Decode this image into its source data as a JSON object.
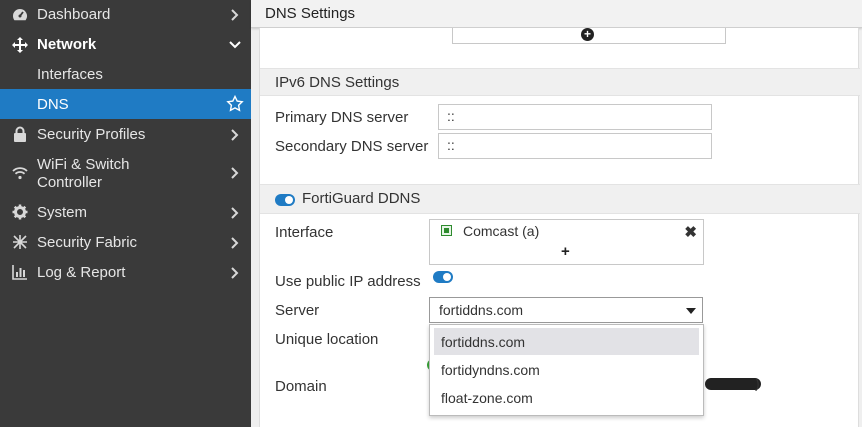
{
  "sidebar": {
    "items": [
      {
        "label": "Dashboard",
        "icon": "dashboard-icon"
      },
      {
        "label": "Network",
        "icon": "network-icon"
      },
      {
        "label": "Interfaces"
      },
      {
        "label": "DNS",
        "icon": "star-icon"
      },
      {
        "label": "Security Profiles",
        "icon": "lock-icon"
      },
      {
        "label": "WiFi & Switch",
        "label2": "Controller",
        "icon": "wifi-icon"
      },
      {
        "label": "System",
        "icon": "gear-icon"
      },
      {
        "label": "Security Fabric",
        "icon": "fabric-icon"
      },
      {
        "label": "Log & Report",
        "icon": "chart-icon"
      }
    ],
    "active_color": "#1f7bc4"
  },
  "header": {
    "title": "DNS Settings"
  },
  "ipv6": {
    "section_title": "IPv6 DNS Settings",
    "primary_label": "Primary DNS server",
    "primary_value": "::",
    "secondary_label": "Secondary DNS server",
    "secondary_value": "::"
  },
  "ddns": {
    "section_title": "FortiGuard DDNS",
    "interface_label": "Interface",
    "interface_value": "Comcast (a)",
    "use_public_ip_label": "Use public IP address",
    "server_label": "Server",
    "server_value": "fortiddns.com",
    "unique_location_label": "Unique location",
    "domain_label": "Domain",
    "domain_suffix": ")",
    "server_options": [
      "fortiddns.com",
      "fortidyndns.com",
      "float-zone.com"
    ]
  }
}
